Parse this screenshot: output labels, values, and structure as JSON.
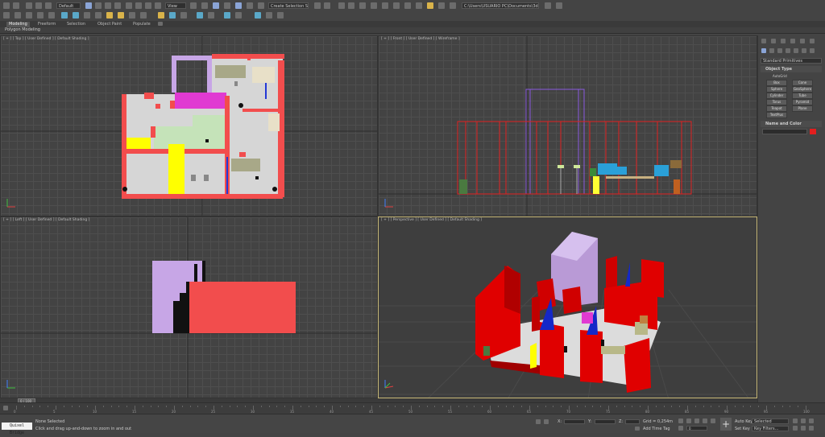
{
  "toolbar": {
    "workspace": "Default",
    "view_mode": "View",
    "selection_set": "Create Selection Se",
    "path": "C:\\Users\\USUARIO PC\\Documents\\3ds Max 2020"
  },
  "ribbon": {
    "tabs": [
      "Modeling",
      "Freeform",
      "Selection",
      "Object Paint",
      "Populate"
    ],
    "sub_label": "Polygon Modeling"
  },
  "viewports": {
    "top": "[ + ] [ Top ] [ User Defined ] [ Default Shading ]",
    "front": "[ + ] [ Front ] [ User Defined ] [ Wireframe ]",
    "left": "[ + ] [ Left ] [ User Defined ] [ Default Shading ]",
    "perspective": "[ + ] [ Perspective ] [ User Defined ] [ Default Shading ]"
  },
  "command_panel": {
    "dropdown": "Standard Primitives",
    "object_type_title": "Object Type",
    "autogrid": "AutoGrid",
    "buttons": [
      "Box",
      "Cone",
      "Sphere",
      "GeoSphere",
      "Cylinder",
      "Tube",
      "Torus",
      "Pyramid",
      "Teapot",
      "Plane",
      "TextPlus"
    ],
    "name_color_title": "Name and Color",
    "object_color": "#e31e1e"
  },
  "timeline": {
    "frame_label": "0 / 100",
    "ticks": [
      "0",
      "5",
      "10",
      "15",
      "20",
      "25",
      "30",
      "35",
      "40",
      "45",
      "50",
      "55",
      "60",
      "65",
      "70",
      "75",
      "80",
      "85",
      "90",
      "95",
      "100"
    ]
  },
  "status": {
    "app_label": "Quixel Bridge",
    "selection": "None Selected",
    "prompt": "Click and drag up-and-down to zoom in and out",
    "x_label": "X:",
    "y_label": "Y:",
    "z_label": "Z:",
    "grid": "Grid = 0,254m",
    "add_time_tag": "Add Time Tag",
    "auto_key": "Auto Key",
    "set_key": "Set Key",
    "selected": "Selected",
    "key_filters": "Key Filters...",
    "frame_value": "0"
  }
}
